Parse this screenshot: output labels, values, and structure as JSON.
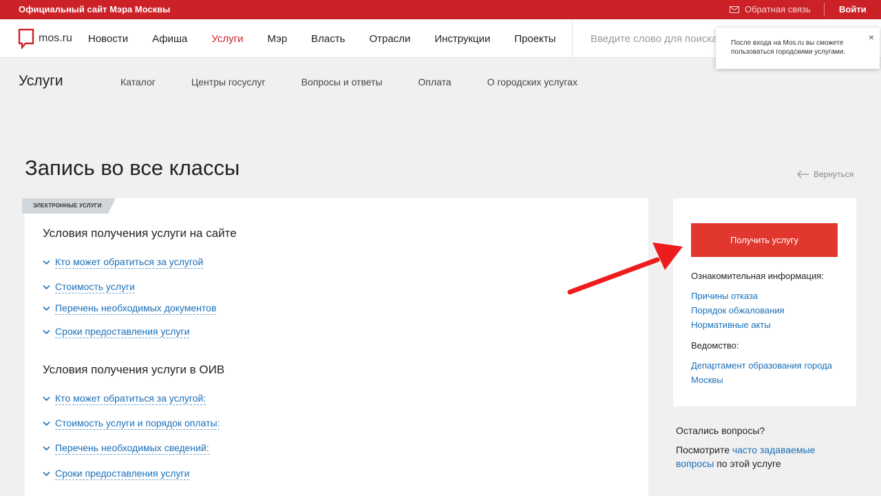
{
  "topbar": {
    "site_name": "Официальный сайт Мэра Москвы",
    "feedback": "Обратная связь",
    "login": "Войти"
  },
  "logo": {
    "text": "mos.ru"
  },
  "nav": {
    "items": [
      "Новости",
      "Афиша",
      "Услуги",
      "Мэр",
      "Власть",
      "Отрасли",
      "Инструкции",
      "Проекты"
    ],
    "active": "Услуги"
  },
  "search": {
    "placeholder": "Введите слово для поиска"
  },
  "popup": {
    "text": "После входа на Mos.ru вы сможете пользоваться городскими услугами.",
    "close": "×"
  },
  "section": {
    "title": "Услуги",
    "subnav": [
      "Каталог",
      "Центры госуслуг",
      "Вопросы и ответы",
      "Оплата",
      "О городских услугах"
    ]
  },
  "page": {
    "title": "Запись во все классы",
    "back": "Вернуться"
  },
  "main": {
    "tag": "ЭЛЕКТРОННЫЕ УСЛУГИ",
    "site_conditions": {
      "title": "Условия получения услуги на сайте",
      "links": [
        "Кто может обратиться за услугой",
        "Стоимость услуги",
        "Перечень необходимых документов",
        "Сроки предоставления услуги"
      ]
    },
    "oiv_conditions": {
      "title": "Условия получения услуги в ОИВ",
      "links": [
        "Кто может обратиться за услугой:",
        "Стоимость услуги и порядок оплаты:",
        "Перечень необходимых сведений:",
        "Сроки предоставления услуги"
      ]
    }
  },
  "sidebar": {
    "button": "Получить услугу",
    "info_label": "Ознакомительная информация:",
    "info_links": [
      "Причины отказа",
      "Порядок обжалования",
      "Нормативные акты"
    ],
    "agency_label": "Ведомство:",
    "agency_link": "Департамент образования города Москвы"
  },
  "questions": {
    "title": "Остались вопросы?",
    "text_before": "Посмотрите",
    "link": "часто задаваемые вопросы",
    "text_after": "по этой услуге"
  },
  "colors": {
    "brand_red": "#cc2127",
    "button_red": "#e2372f",
    "link_blue": "#1a6fb8",
    "arrow_red": "#ee1c1c"
  }
}
